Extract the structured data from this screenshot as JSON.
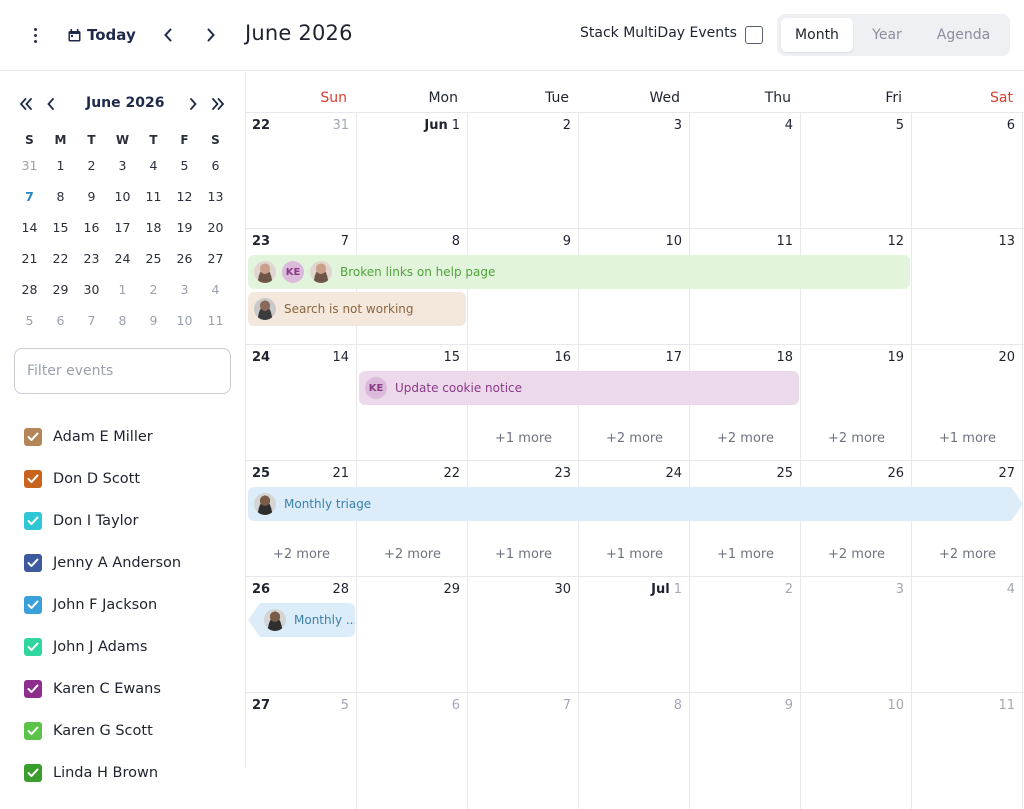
{
  "header": {
    "today_label": "Today",
    "title": "June 2026",
    "stack_label": "Stack MultiDay Events",
    "views": [
      "Month",
      "Year",
      "Agenda"
    ],
    "active_view": "Month"
  },
  "mini_calendar": {
    "title": "June 2026",
    "dow": [
      "S",
      "M",
      "T",
      "W",
      "T",
      "F",
      "S"
    ],
    "selected_day": "7",
    "weeks": [
      [
        "31",
        "1",
        "2",
        "3",
        "4",
        "5",
        "6"
      ],
      [
        "7",
        "8",
        "9",
        "10",
        "11",
        "12",
        "13"
      ],
      [
        "14",
        "15",
        "16",
        "17",
        "18",
        "19",
        "20"
      ],
      [
        "21",
        "22",
        "23",
        "24",
        "25",
        "26",
        "27"
      ],
      [
        "28",
        "29",
        "30",
        "1",
        "2",
        "3",
        "4"
      ],
      [
        "5",
        "6",
        "7",
        "8",
        "9",
        "10",
        "11"
      ]
    ]
  },
  "filter": {
    "placeholder": "Filter events"
  },
  "people": [
    {
      "name": "Adam E Miller",
      "color": "#b5855a"
    },
    {
      "name": "Don D Scott",
      "color": "#c8641e"
    },
    {
      "name": "Don I Taylor",
      "color": "#2fc6d6"
    },
    {
      "name": "Jenny A Anderson",
      "color": "#3e5a9e"
    },
    {
      "name": "John F Jackson",
      "color": "#3aa0dc"
    },
    {
      "name": "John J Adams",
      "color": "#2fd6a0"
    },
    {
      "name": "Karen C Ewans",
      "color": "#8e2f8e"
    },
    {
      "name": "Karen G Scott",
      "color": "#5cc34a"
    },
    {
      "name": "Linda H Brown",
      "color": "#3a9e2f"
    }
  ],
  "month": {
    "dow": [
      "Sun",
      "Mon",
      "Tue",
      "Wed",
      "Thu",
      "Fri",
      "Sat"
    ],
    "weeks": [
      {
        "week": "22",
        "days": [
          "31",
          "1",
          "2",
          "3",
          "4",
          "5",
          "6"
        ],
        "month_label": "Jun",
        "more": [
          "",
          "",
          "",
          "",
          "",
          "",
          ""
        ]
      },
      {
        "week": "23",
        "days": [
          "7",
          "8",
          "9",
          "10",
          "11",
          "12",
          "13"
        ],
        "more": [
          "",
          "",
          "",
          "",
          "",
          "",
          ""
        ]
      },
      {
        "week": "24",
        "days": [
          "14",
          "15",
          "16",
          "17",
          "18",
          "19",
          "20"
        ],
        "more": [
          "",
          "",
          "+1 more",
          "+2 more",
          "+2 more",
          "+2 more",
          "+1 more"
        ]
      },
      {
        "week": "25",
        "days": [
          "21",
          "22",
          "23",
          "24",
          "25",
          "26",
          "27"
        ],
        "more": [
          "+2 more",
          "+2 more",
          "+1 more",
          "+1 more",
          "+1 more",
          "+2 more",
          "+2 more"
        ]
      },
      {
        "week": "26",
        "days": [
          "28",
          "29",
          "30",
          "1",
          "2",
          "3",
          "4"
        ],
        "month_label": "Jul",
        "more": [
          "",
          "",
          "",
          "",
          "",
          "",
          ""
        ]
      },
      {
        "week": "27",
        "days": [
          "5",
          "6",
          "7",
          "8",
          "9",
          "10",
          "11"
        ],
        "more": [
          "",
          "",
          "",
          "",
          "",
          "",
          ""
        ]
      }
    ],
    "events": {
      "broken_links": "Broken links on help page",
      "search": "Search is not working",
      "cookie": "Update cookie notice",
      "triage": "Monthly triage",
      "triage_short": "Monthly ..."
    },
    "initials": "KE"
  }
}
